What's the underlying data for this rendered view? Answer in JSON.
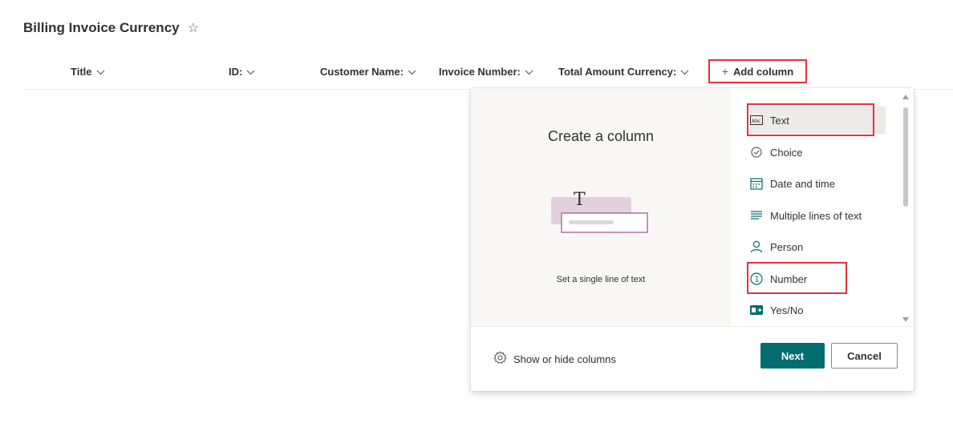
{
  "list": {
    "title": "Billing Invoice Currency"
  },
  "columns": [
    {
      "label": "Title"
    },
    {
      "label": "ID:"
    },
    {
      "label": "Customer Name:"
    },
    {
      "label": "Invoice Number:"
    },
    {
      "label": "Total Amount Currency:"
    }
  ],
  "add_column": {
    "label": "Add column"
  },
  "panel": {
    "heading": "Create a column",
    "description": "Set a single line of text",
    "types": [
      {
        "label": "Text",
        "icon": "text-field-icon",
        "selected": true
      },
      {
        "label": "Choice",
        "icon": "choice-icon"
      },
      {
        "label": "Date and time",
        "icon": "calendar-icon"
      },
      {
        "label": "Multiple lines of text",
        "icon": "multiline-text-icon"
      },
      {
        "label": "Person",
        "icon": "person-icon"
      },
      {
        "label": "Number",
        "icon": "number-icon"
      },
      {
        "label": "Yes/No",
        "icon": "yes-no-icon"
      }
    ],
    "footer": {
      "show_hide": "Show or hide columns",
      "next": "Next",
      "cancel": "Cancel"
    }
  },
  "colors": {
    "accent": "#036c70",
    "highlight": "#e8303a"
  }
}
